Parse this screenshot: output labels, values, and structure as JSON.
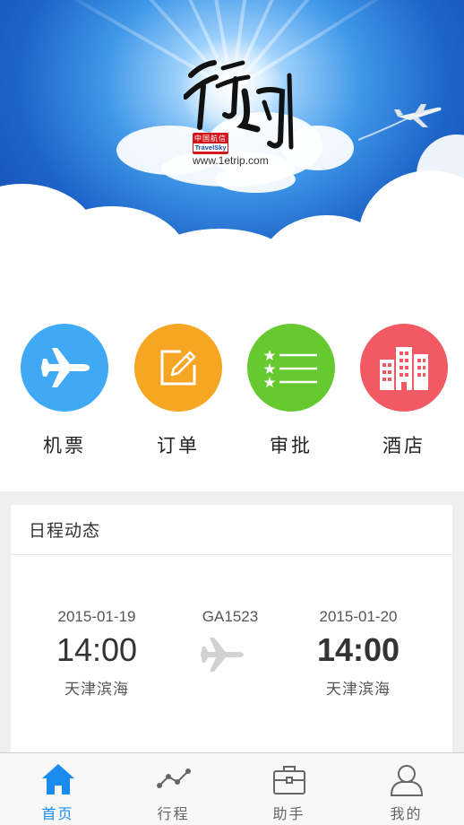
{
  "banner": {
    "brand_cn": "中国航信",
    "brand_en": "TravelSky",
    "url": "www.1etrip.com"
  },
  "quick_menu": [
    {
      "label": "机票",
      "icon": "airplane-icon",
      "color": "#3fa9f5"
    },
    {
      "label": "订单",
      "icon": "edit-order-icon",
      "color": "#f7a623"
    },
    {
      "label": "审批",
      "icon": "approval-list-icon",
      "color": "#66c92f"
    },
    {
      "label": "酒店",
      "icon": "hotel-building-icon",
      "color": "#f25a63"
    }
  ],
  "schedule": {
    "title": "日程动态",
    "departure": {
      "date": "2015-01-19",
      "time": "14:00",
      "city": "天津滨海"
    },
    "flight_no": "GA1523",
    "arrival": {
      "date": "2015-01-20",
      "time": "14:00",
      "city": "天津滨海"
    }
  },
  "tabs": [
    {
      "label": "首页",
      "icon": "home-icon",
      "active": true
    },
    {
      "label": "行程",
      "icon": "trip-line-icon",
      "active": false
    },
    {
      "label": "助手",
      "icon": "briefcase-icon",
      "active": false
    },
    {
      "label": "我的",
      "icon": "user-icon",
      "active": false
    }
  ],
  "colors": {
    "accent": "#1a8cf0",
    "sky": "#1e64c8"
  }
}
